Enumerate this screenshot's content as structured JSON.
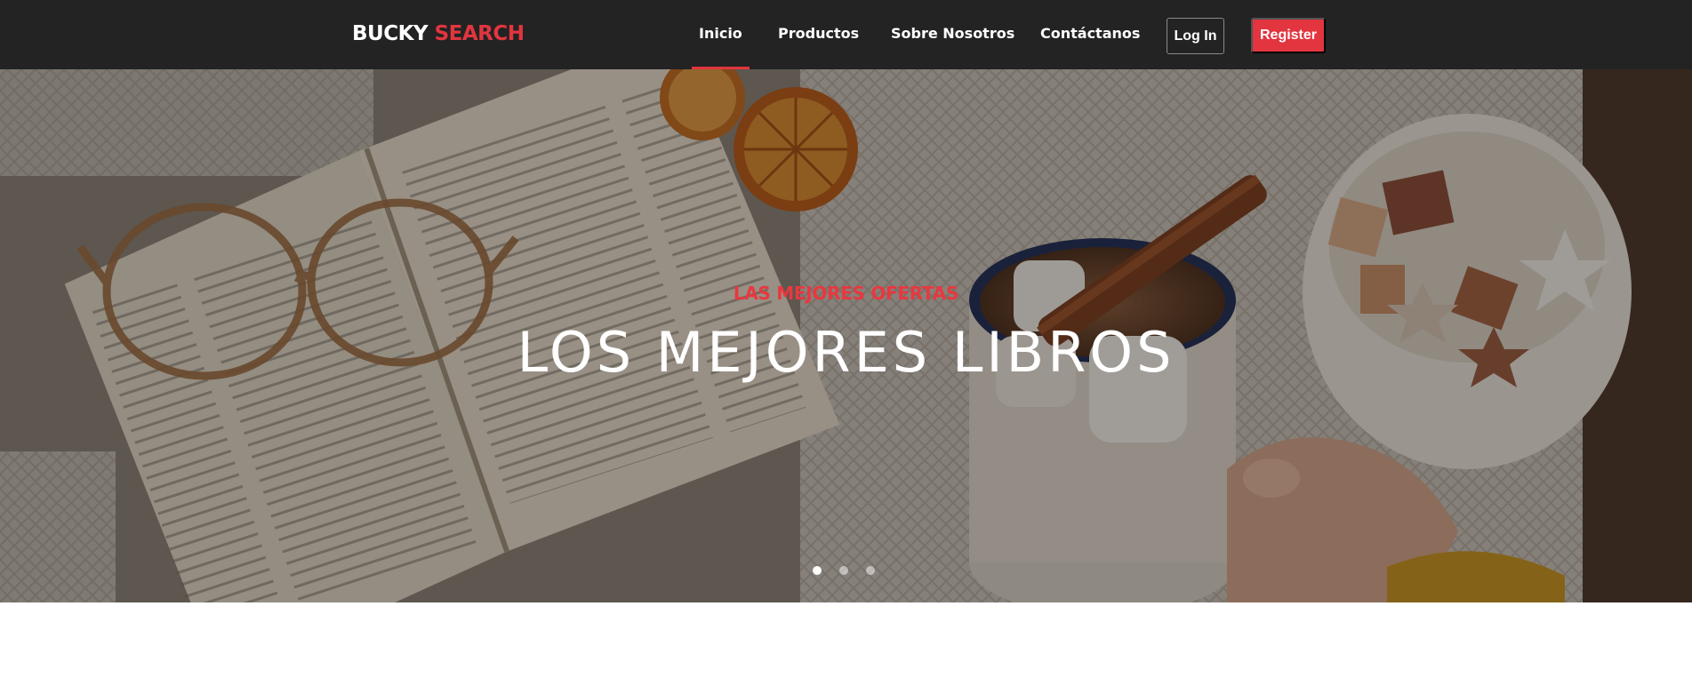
{
  "brand": {
    "part1": "BUCKY",
    "part2": "SEARCH"
  },
  "nav": {
    "links": [
      {
        "label": "Inicio",
        "active": true
      },
      {
        "label": "Productos",
        "active": false
      },
      {
        "label": "Sobre Nosotros",
        "active": false
      },
      {
        "label": "Contáctanos",
        "active": false
      }
    ],
    "login_label": "Log In",
    "register_label": "Register"
  },
  "hero": {
    "eyebrow": "LAS MEJORES OFERTAS",
    "title": "LOS MEJORES LIBROS",
    "slides_count": 3,
    "active_slide": 1
  },
  "colors": {
    "accent": "#e2353f",
    "navbar_bg": "#232323"
  }
}
